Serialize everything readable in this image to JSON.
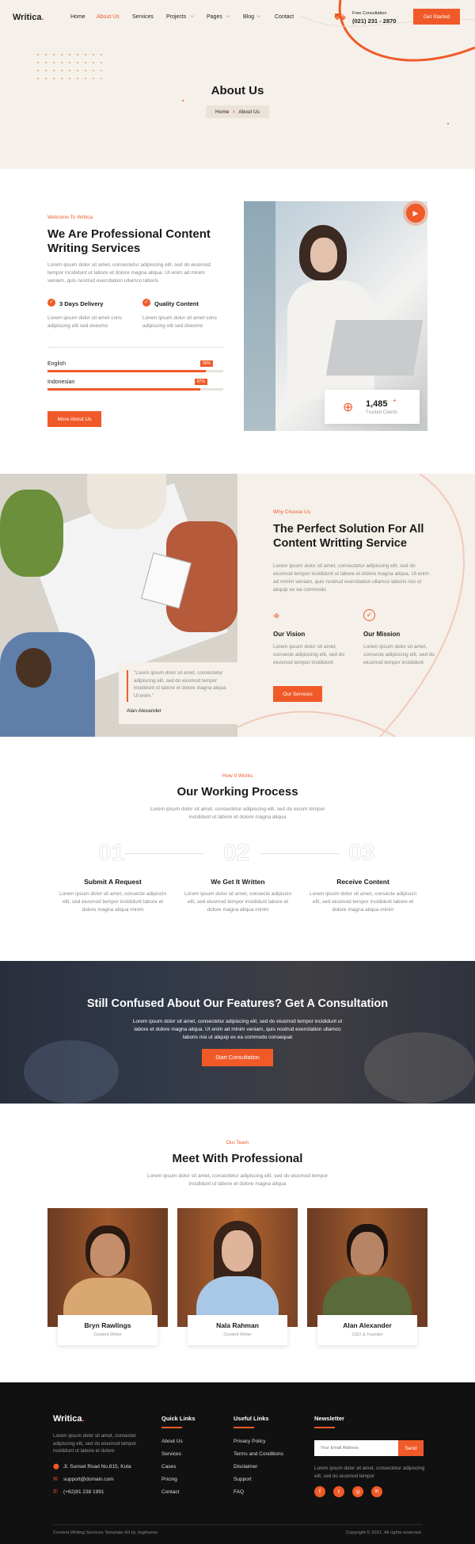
{
  "brand": {
    "name": "Writica",
    "dot": "."
  },
  "nav": {
    "items": [
      "Home",
      "About Us",
      "Services",
      "Projects",
      "Pages",
      "Blog",
      "Contact"
    ],
    "active": "About Us"
  },
  "header": {
    "consult_label": "Free Consultation",
    "phone": "(021) 231 - 2870",
    "cta": "Get Started"
  },
  "hero": {
    "title": "About Us",
    "crumb_home": "Home",
    "crumb_sep": ">",
    "crumb_current": "About Us"
  },
  "about": {
    "eyebrow": "Welcome To Writica",
    "title_1": "We Are Professional Content",
    "title_2": "Writing Services",
    "text": "Lorem ipsum dolor sit amet, consectetur adipiscing elit, sed do eiusmod tempor incididunt ut labore et dolore magna aliqua. Ut enim ad minim veniam, quis nostrud exercitation ullamco laboris",
    "features": [
      {
        "title": "3 Days Delivery",
        "text": "Lorem ipsum dolor sit amet cons adipiscing elit sed doesmo"
      },
      {
        "title": "Quality Content",
        "text": "Lorem ipsum dolor sit amet cons adipiscing elit sed doesmo"
      }
    ],
    "skills": [
      {
        "label": "English",
        "value": 90,
        "pct": "90%"
      },
      {
        "label": "Indonesian",
        "value": 87,
        "pct": "87%"
      }
    ],
    "button": "More About Us",
    "stat_value": "1,485",
    "stat_plus": "+",
    "stat_label": "Trusted Clients"
  },
  "why": {
    "eyebrow": "Why Choose Us",
    "title_1": "The Perfect Solution For All",
    "title_2": "Content Writting Service",
    "text": "Lorem ipsum dolor sit amet, consectetur adipiscing elit, sed do eiusmod tempor incididunt ut labore et dolore magna aliqua. Ut enim ad minim veniam, quis nostrud exercitation ullamco laboris nisi ut aliquip ex ea commodo",
    "vision_title": "Our Vision",
    "vision_text": "Lorem ipsum dolor sit amet, consecte adipiscing elit, sed do eiusmod tempor incididunt",
    "mission_title": "Our Mission",
    "mission_text": "Lorem ipsum dolor sit amet, consecte adipiscing elit, sed do eiusmod tempor incididunt",
    "button": "Our Services",
    "quote": "\"Lorem ipsum dolor sit amet, consectetur adipiscing elit, sed do eiusmod tempor incididunt ut labore et dolore magna aliqua Ut enim.\"",
    "quote_author": "Alan Alexander"
  },
  "process": {
    "eyebrow": "How It Works",
    "title": "Our Working Process",
    "text": "Lorem ipsum dolor sit amet, consectetur adipiscing elit, sed do eiusm tempor incididunt ut labore et dolore magna aliqua",
    "steps": [
      {
        "num": "01",
        "title": "Submit A Request",
        "text": "Lorem ipsum dolor sit amet, consecte adipiscin elit, sed eiusmod tempor incididunt labore et dolore magna aliqua minim"
      },
      {
        "num": "02",
        "title": "We Get It Written",
        "text": "Lorem ipsum dolor sit amet, consecte adipiscin elit, sed eiusmod tempor incididunt labore et dolore magna aliqua minim"
      },
      {
        "num": "03",
        "title": "Receive Content",
        "text": "Lorem ipsum dolor sit amet, consecte adipiscin elit, sed eiusmod tempor incididunt labore et dolore magna aliqua minim"
      }
    ]
  },
  "cta": {
    "title": "Still Confused About Our Features? Get A Consultation",
    "text": "Lorem ipsum dolor sit amet, consectetur adipiscing elit, sed do eiusmod tempor incididunt ut labore et dolore magna aliqua. Ut enim ad minim veniam, quis nostrud exercitation ullamco laboris nisi ut aliquip ex ea commodo consequat",
    "button": "Start Consultation"
  },
  "team": {
    "eyebrow": "Our Team",
    "title": "Meet With Professional",
    "text": "Lorem ipsum dolor sit amet, consectetur adipiscing elit, sed do eiusmod tempor incididunt ut labore et dolore magna aliqua",
    "members": [
      {
        "name": "Bryn Rawlings",
        "role": "Content Writer"
      },
      {
        "name": "Nala Rahman",
        "role": "Content Writer"
      },
      {
        "name": "Alan Alexander",
        "role": "CEO & Founder"
      }
    ]
  },
  "footer": {
    "about": "Lorem ipsum dolor sit amet, consectet adipiscing elit, sed do eiusmod tempor incididunt ut labore et dolore",
    "address": "Jl. Sunset Road No.815, Kuta",
    "email": "support@domain.com",
    "phone": "(+62)81 238 1991",
    "quick_title": "Quick Links",
    "quick_links": [
      "About Us",
      "Services",
      "Cases",
      "Pricing",
      "Contact"
    ],
    "useful_title": "Useful Links",
    "useful_links": [
      "Privacy Policy",
      "Terms and Conditions",
      "Disclaimer",
      "Support",
      "FAQ"
    ],
    "news_title": "Newsletter",
    "news_placeholder": "Your Email Address",
    "news_button": "Send",
    "news_text": "Lorem ipsum dolor sit amet, consectetur adipiscing elit, sed do eiusmod tempor",
    "social": [
      "f",
      "t",
      "◎",
      "in"
    ],
    "credit": "Content Writing Services Template Kit by Jegtheme",
    "copyright": "Copyright © 2021. All rights reserved."
  },
  "colors": {
    "accent": "#f05a28",
    "cream": "#f5f0ea",
    "dark": "#111111"
  }
}
